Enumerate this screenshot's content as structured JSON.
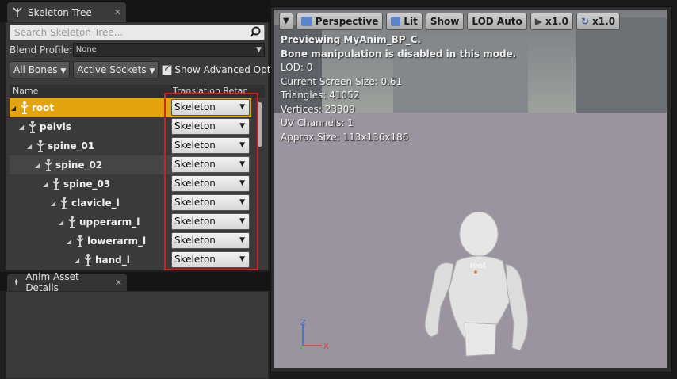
{
  "left_tab": {
    "title": "Skeleton Tree",
    "close": "✕"
  },
  "search": {
    "placeholder": "Search Skeleton Tree..."
  },
  "blend_profile": {
    "label": "Blend Profile:",
    "value": "None"
  },
  "filters": {
    "bones_label": "All Bones",
    "sockets_label": "Active Sockets",
    "advanced_label": "Show Advanced Option"
  },
  "columns": {
    "name": "Name",
    "translation": "Translation Retar"
  },
  "bones": [
    {
      "name": "root",
      "retarget": "Skeleton"
    },
    {
      "name": "pelvis",
      "retarget": "Skeleton"
    },
    {
      "name": "spine_01",
      "retarget": "Skeleton"
    },
    {
      "name": "spine_02",
      "retarget": "Skeleton"
    },
    {
      "name": "spine_03",
      "retarget": "Skeleton"
    },
    {
      "name": "clavicle_l",
      "retarget": "Skeleton"
    },
    {
      "name": "upperarm_l",
      "retarget": "Skeleton"
    },
    {
      "name": "lowerarm_l",
      "retarget": "Skeleton"
    },
    {
      "name": "hand_l",
      "retarget": "Skeleton"
    }
  ],
  "bottom_tab": {
    "title": "Anim Asset Details",
    "close": "✕"
  },
  "viewport": {
    "toolbar": {
      "perspective": "Perspective",
      "lit": "Lit",
      "show": "Show",
      "lod": "LOD Auto",
      "play_rate": "x1.0",
      "cam_speed": "x1.0"
    },
    "stats": [
      "Previewing MyAnim_BP_C.",
      "Bone manipulation is disabled in this mode.",
      "LOD: 0",
      "Current Screen Size: 0.61",
      "Triangles: 41052",
      "Vertices: 23309",
      "UV Channels: 1",
      "Approx Size: 113x136x186"
    ],
    "bone_label": "root",
    "axis_labels": {
      "z": "Z",
      "x": "X"
    }
  },
  "colors": {
    "selection": "#e3a40f",
    "highlight_box": "#d61f1f",
    "panel": "#3a3a3a"
  }
}
